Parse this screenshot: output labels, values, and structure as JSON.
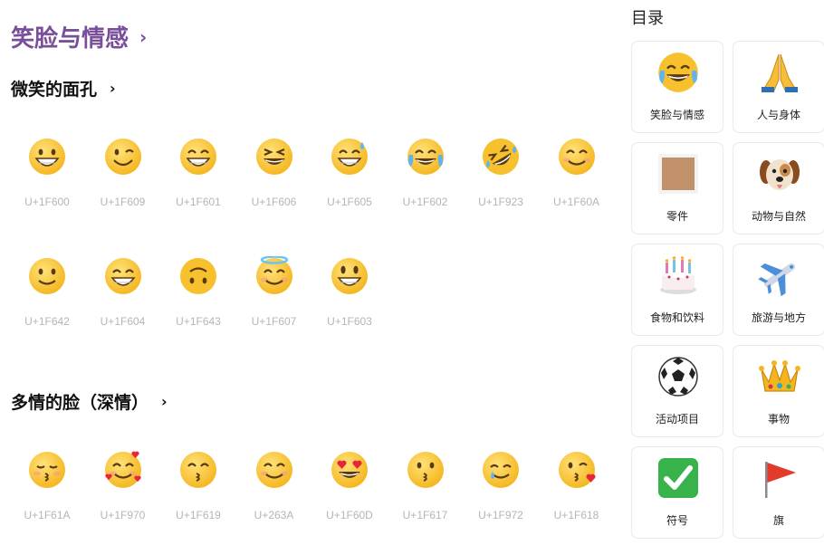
{
  "page": {
    "title": "笑脸与情感",
    "chevron": "›"
  },
  "sections": [
    {
      "title": "微笑的面孔",
      "emojis": [
        {
          "code": "U+1F600",
          "icon": "grinning-face-icon"
        },
        {
          "code": "U+1F609",
          "icon": "winking-face-icon"
        },
        {
          "code": "U+1F601",
          "icon": "beaming-face-icon"
        },
        {
          "code": "U+1F606",
          "icon": "squinting-laughing-face-icon"
        },
        {
          "code": "U+1F605",
          "icon": "grinning-sweat-face-icon"
        },
        {
          "code": "U+1F602",
          "icon": "tears-of-joy-face-icon"
        },
        {
          "code": "U+1F923",
          "icon": "rolling-on-floor-laughing-icon"
        },
        {
          "code": "U+1F60A",
          "icon": "smiling-eyes-face-icon"
        },
        {
          "code": "U+1F642",
          "icon": "slightly-smiling-face-icon"
        },
        {
          "code": "U+1F604",
          "icon": "grinning-smiling-eyes-face-icon"
        },
        {
          "code": "U+1F643",
          "icon": "upside-down-face-icon"
        },
        {
          "code": "U+1F607",
          "icon": "halo-face-icon"
        },
        {
          "code": "U+1F603",
          "icon": "big-eyes-grinning-face-icon"
        }
      ]
    },
    {
      "title": "多情的脸（深情）",
      "emojis": [
        {
          "code": "U+1F61A",
          "icon": "kissing-closed-eyes-face-icon"
        },
        {
          "code": "U+1F970",
          "icon": "smiling-hearts-face-icon"
        },
        {
          "code": "U+1F619",
          "icon": "kissing-smiling-eyes-face-icon"
        },
        {
          "code": "U+263A",
          "icon": "smiling-face-icon"
        },
        {
          "code": "U+1F60D",
          "icon": "heart-eyes-face-icon"
        },
        {
          "code": "U+1F617",
          "icon": "kissing-face-icon"
        },
        {
          "code": "U+1F972",
          "icon": "smiling-tear-face-icon"
        },
        {
          "code": "U+1F618",
          "icon": "blowing-kiss-face-icon"
        }
      ]
    }
  ],
  "toc": {
    "title": "目录",
    "items": [
      {
        "label": "笑脸与情感",
        "icon": "laughing-tears-icon"
      },
      {
        "label": "人与身体",
        "icon": "folded-hands-icon"
      },
      {
        "label": "零件",
        "icon": "skin-tone-swatch-icon"
      },
      {
        "label": "动物与自然",
        "icon": "dog-face-icon"
      },
      {
        "label": "食物和饮料",
        "icon": "birthday-cake-icon"
      },
      {
        "label": "旅游与地方",
        "icon": "airplane-icon"
      },
      {
        "label": "活动项目",
        "icon": "soccer-ball-icon"
      },
      {
        "label": "事物",
        "icon": "crown-icon"
      },
      {
        "label": "符号",
        "icon": "check-mark-button-icon"
      },
      {
        "label": "旗",
        "icon": "triangular-flag-icon"
      }
    ]
  },
  "colors": {
    "accent": "#7a4f9a",
    "code_text": "#b5b5b5",
    "emoji_yellow": "#f7c12e",
    "swatch": "#c1926a"
  }
}
